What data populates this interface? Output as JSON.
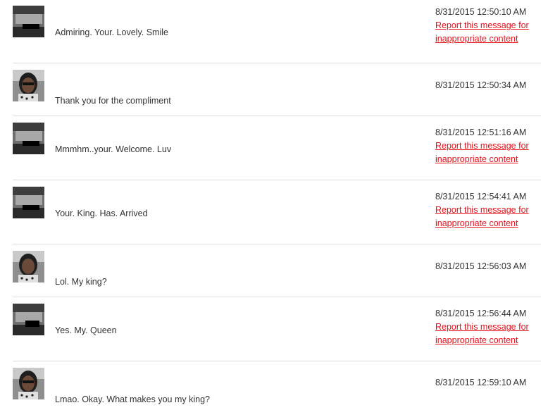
{
  "report_link_text": "Report this message for inappropriate content",
  "colors": {
    "report_link": "#e4131e",
    "divider": "#dcdcdc",
    "text": "#333333"
  },
  "messages": [
    {
      "sender": "other",
      "avatar": "car-interior-photo",
      "text": "Admiring. Your. Lovely. Smile",
      "timestamp": "8/31/2015 12:50:10 AM",
      "reportable": true
    },
    {
      "sender": "self",
      "avatar": "woman-with-glasses-photo",
      "text": "Thank you for the compliment",
      "timestamp": "8/31/2015 12:50:34 AM",
      "reportable": false
    },
    {
      "sender": "other",
      "avatar": "car-interior-photo",
      "text": "Mmmhm..your. Welcome. Luv",
      "timestamp": "8/31/2015 12:51:16 AM",
      "reportable": true
    },
    {
      "sender": "other",
      "avatar": "car-interior-photo",
      "text": "Your. King. Has. Arrived",
      "timestamp": "8/31/2015 12:54:41 AM",
      "reportable": true
    },
    {
      "sender": "self",
      "avatar": "woman-with-glasses-photo",
      "text": "Lol. My king?",
      "timestamp": "8/31/2015 12:56:03 AM",
      "reportable": false
    },
    {
      "sender": "other",
      "avatar": "car-interior-photo",
      "text": "Yes. My. Queen",
      "timestamp": "8/31/2015 12:56:44 AM",
      "reportable": true
    },
    {
      "sender": "self",
      "avatar": "woman-with-glasses-photo",
      "text": "Lmao. Okay. What makes you my king?",
      "timestamp": "8/31/2015 12:59:10 AM",
      "reportable": false
    }
  ]
}
